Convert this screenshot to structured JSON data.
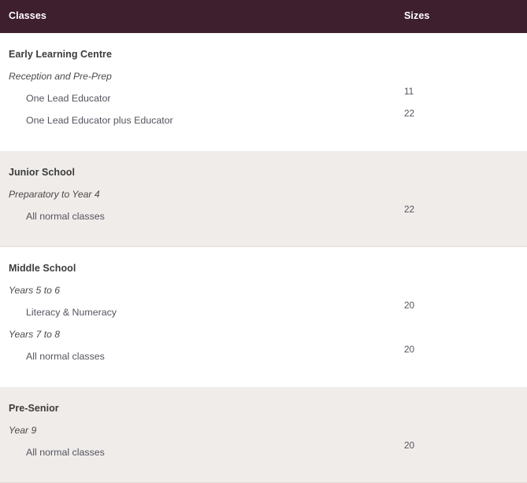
{
  "header": {
    "classes_label": "Classes",
    "sizes_label": "Sizes",
    "background_color": "#3d1f2d",
    "text_color": "#ffffff"
  },
  "colors": {
    "header_bar": "#3d1f2d",
    "row_shaded": "#f0ecea",
    "row_plain": "#ffffff",
    "section_title": "#3c3c3c",
    "subheading": "#4a4a4a",
    "body_text": "#54545e"
  },
  "sections": [
    {
      "title": "Early Learning Centre",
      "shaded": false,
      "groups": [
        {
          "subheading": "Reception and Pre-Prep",
          "rows": [
            {
              "label": "One Lead Educator",
              "size": "11"
            },
            {
              "label": "One Lead Educator plus Educator",
              "size": "22"
            }
          ]
        }
      ]
    },
    {
      "title": "Junior School",
      "shaded": true,
      "groups": [
        {
          "subheading": "Preparatory to Year 4",
          "rows": [
            {
              "label": "All normal classes",
              "size": "22"
            }
          ]
        }
      ]
    },
    {
      "title": "Middle School",
      "shaded": false,
      "groups": [
        {
          "subheading": "Years 5 to 6",
          "rows": [
            {
              "label": "Literacy & Numeracy",
              "size": "20"
            }
          ]
        },
        {
          "subheading": "Years 7 to 8",
          "rows": [
            {
              "label": "All normal classes",
              "size": "20"
            }
          ]
        }
      ]
    },
    {
      "title": "Pre-Senior",
      "shaded": true,
      "groups": [
        {
          "subheading": "Year 9",
          "rows": [
            {
              "label": "All normal classes",
              "size": "20"
            }
          ]
        }
      ]
    }
  ]
}
